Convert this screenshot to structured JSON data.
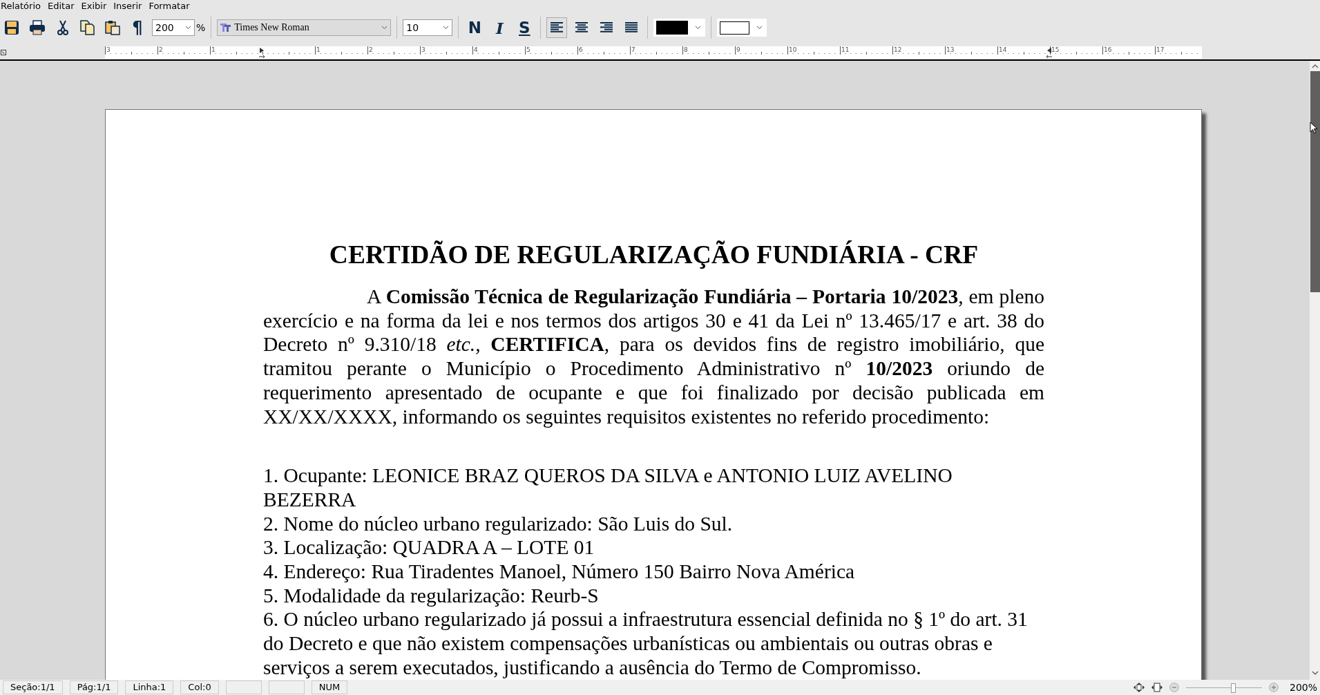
{
  "menu": [
    "Relatório",
    "Editar",
    "Exibir",
    "Inserir",
    "Formatar"
  ],
  "toolbar": {
    "zoom": "200",
    "zoom_unit": "%",
    "font": "Times New Roman",
    "size": "10",
    "pilcrow": "¶",
    "styles": [
      {
        "kind": "bold",
        "label": "N"
      },
      {
        "kind": "italic",
        "label": "I"
      },
      {
        "kind": "underline",
        "label": "S"
      }
    ],
    "alignments": [
      {
        "kind": "left",
        "selected": true
      },
      {
        "kind": "center",
        "selected": false
      },
      {
        "kind": "right",
        "selected": false
      },
      {
        "kind": "justify",
        "selected": false
      }
    ],
    "color_pickers": [
      {
        "kind": "text",
        "color": "#000000"
      },
      {
        "kind": "background",
        "color": "#ffffff"
      }
    ]
  },
  "ruler": {
    "left_labels": [
      "3",
      "2",
      "1"
    ],
    "right_labels": [
      "1",
      "2",
      "3",
      "4",
      "5",
      "6",
      "7",
      "8",
      "9",
      "10",
      "11",
      "12",
      "13",
      "14",
      "15",
      "16",
      "17"
    ]
  },
  "document": {
    "title": "CERTIDÃO DE REGULARIZAÇÃO FUNDIÁRIA - CRF",
    "paragraph": "A **Comissão Técnica de Regularização Fundiária – Portaria 10/2023**, em pleno exercício e na forma da lei e nos termos dos artigos 30 e 41 da Lei nº 13.465/17 e art. 38 do Decreto nº 9.310/18 *etc.,* **CERTIFICA**, para os devidos fins de registro imobiliário, que tramitou perante o Município o Procedimento Administrativo nº **10/2023** oriundo de requerimento apresentado de ocupante e que foi finalizado por decisão publicada em XX/XX/XXXX, informando os seguintes requisitos existentes no referido procedimento:",
    "items": [
      "1. Ocupante: LEONICE BRAZ QUEROS DA SILVA e ANTONIO LUIZ AVELINO BEZERRA",
      "2. Nome do núcleo urbano regularizado: São Luis do Sul.",
      "3. Localização: QUADRA A – LOTE 01",
      "4. Endereço: Rua Tiradentes Manoel, Número 150 Bairro Nova América",
      "5. Modalidade da regularização: Reurb-S",
      "6. O núcleo urbano regularizado já possui a infraestrutura essencial definida no § 1º do art. 31 do Decreto e que não existem compensações urbanísticas ou ambientais ou outras obras e serviços a serem executados, justificando a ausência do Termo de Compromisso."
    ]
  },
  "status_bar": {
    "fields": [
      "Seção:1/1",
      "Pág:1/1",
      "Linha:1",
      "Col:0"
    ],
    "num_indicator": "NUM",
    "zoom_slider": {
      "level": 0.62
    },
    "zoom": "200%"
  }
}
